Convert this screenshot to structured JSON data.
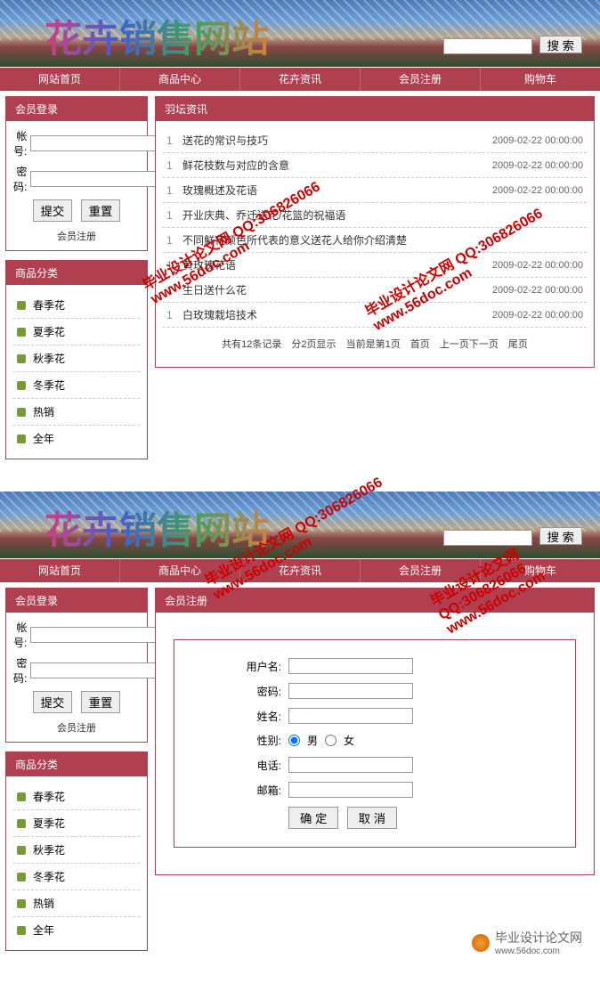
{
  "banner": {
    "title": "花卉销售网站",
    "search_button": "搜 索"
  },
  "nav": {
    "items": [
      "网站首页",
      "商品中心",
      "花卉资讯",
      "会员注册",
      "购物车"
    ]
  },
  "sidebar": {
    "login": {
      "header": "会员登录",
      "account_label": "帐号:",
      "password_label": "密码:",
      "submit": "提交",
      "reset": "重置",
      "register_link": "会员注册"
    },
    "categories": {
      "header": "商品分类",
      "items": [
        "春季花",
        "夏季花",
        "秋季花",
        "冬季花",
        "热销",
        "全年"
      ]
    }
  },
  "news_panel": {
    "header": "羽坛资讯",
    "items": [
      {
        "num": "1",
        "title": "送花的常识与技巧",
        "date": "2009-02-22 00:00:00"
      },
      {
        "num": "1",
        "title": "鲜花枝数与对应的含意",
        "date": "2009-02-22 00:00:00"
      },
      {
        "num": "1",
        "title": "玫瑰概述及花语",
        "date": "2009-02-22 00:00:00"
      },
      {
        "num": "1",
        "title": "开业庆典、乔迁送花/花篮的祝福语",
        "date": ""
      },
      {
        "num": "1",
        "title": "不同鲜花颜色所代表的意义送花人给你介绍清楚",
        "date": ""
      },
      {
        "num": "1",
        "title": "黄玫瑰花语",
        "date": "2009-02-22 00:00:00"
      },
      {
        "num": "1",
        "title": "生日送什么花",
        "date": "2009-02-22 00:00:00"
      },
      {
        "num": "1",
        "title": "白玫瑰栽培技术",
        "date": "2009-02-22 00:00:00"
      }
    ],
    "pagination": {
      "total": "共有12条记录",
      "pages": "分2页显示",
      "current": "当前是第1页",
      "first": "首页",
      "prev_next": "上一页下一页",
      "last": "尾页"
    }
  },
  "register_panel": {
    "header": "会员注册",
    "fields": {
      "username": "用户名:",
      "password": "密码:",
      "name": "姓名:",
      "gender": "性别:",
      "gender_male": "男",
      "gender_female": "女",
      "phone": "电话:",
      "email": "邮箱:"
    },
    "confirm": "确 定",
    "cancel": "取 消"
  },
  "watermarks": [
    {
      "text": "毕业设计论文网 QQ:306826066",
      "sub": "www.56doc.com"
    },
    {
      "text": "毕业设计论文网 QQ:306826066",
      "sub": "www.56doc.com"
    }
  ],
  "footer": {
    "text": "毕业设计论文网",
    "url": "www.56doc.com"
  }
}
